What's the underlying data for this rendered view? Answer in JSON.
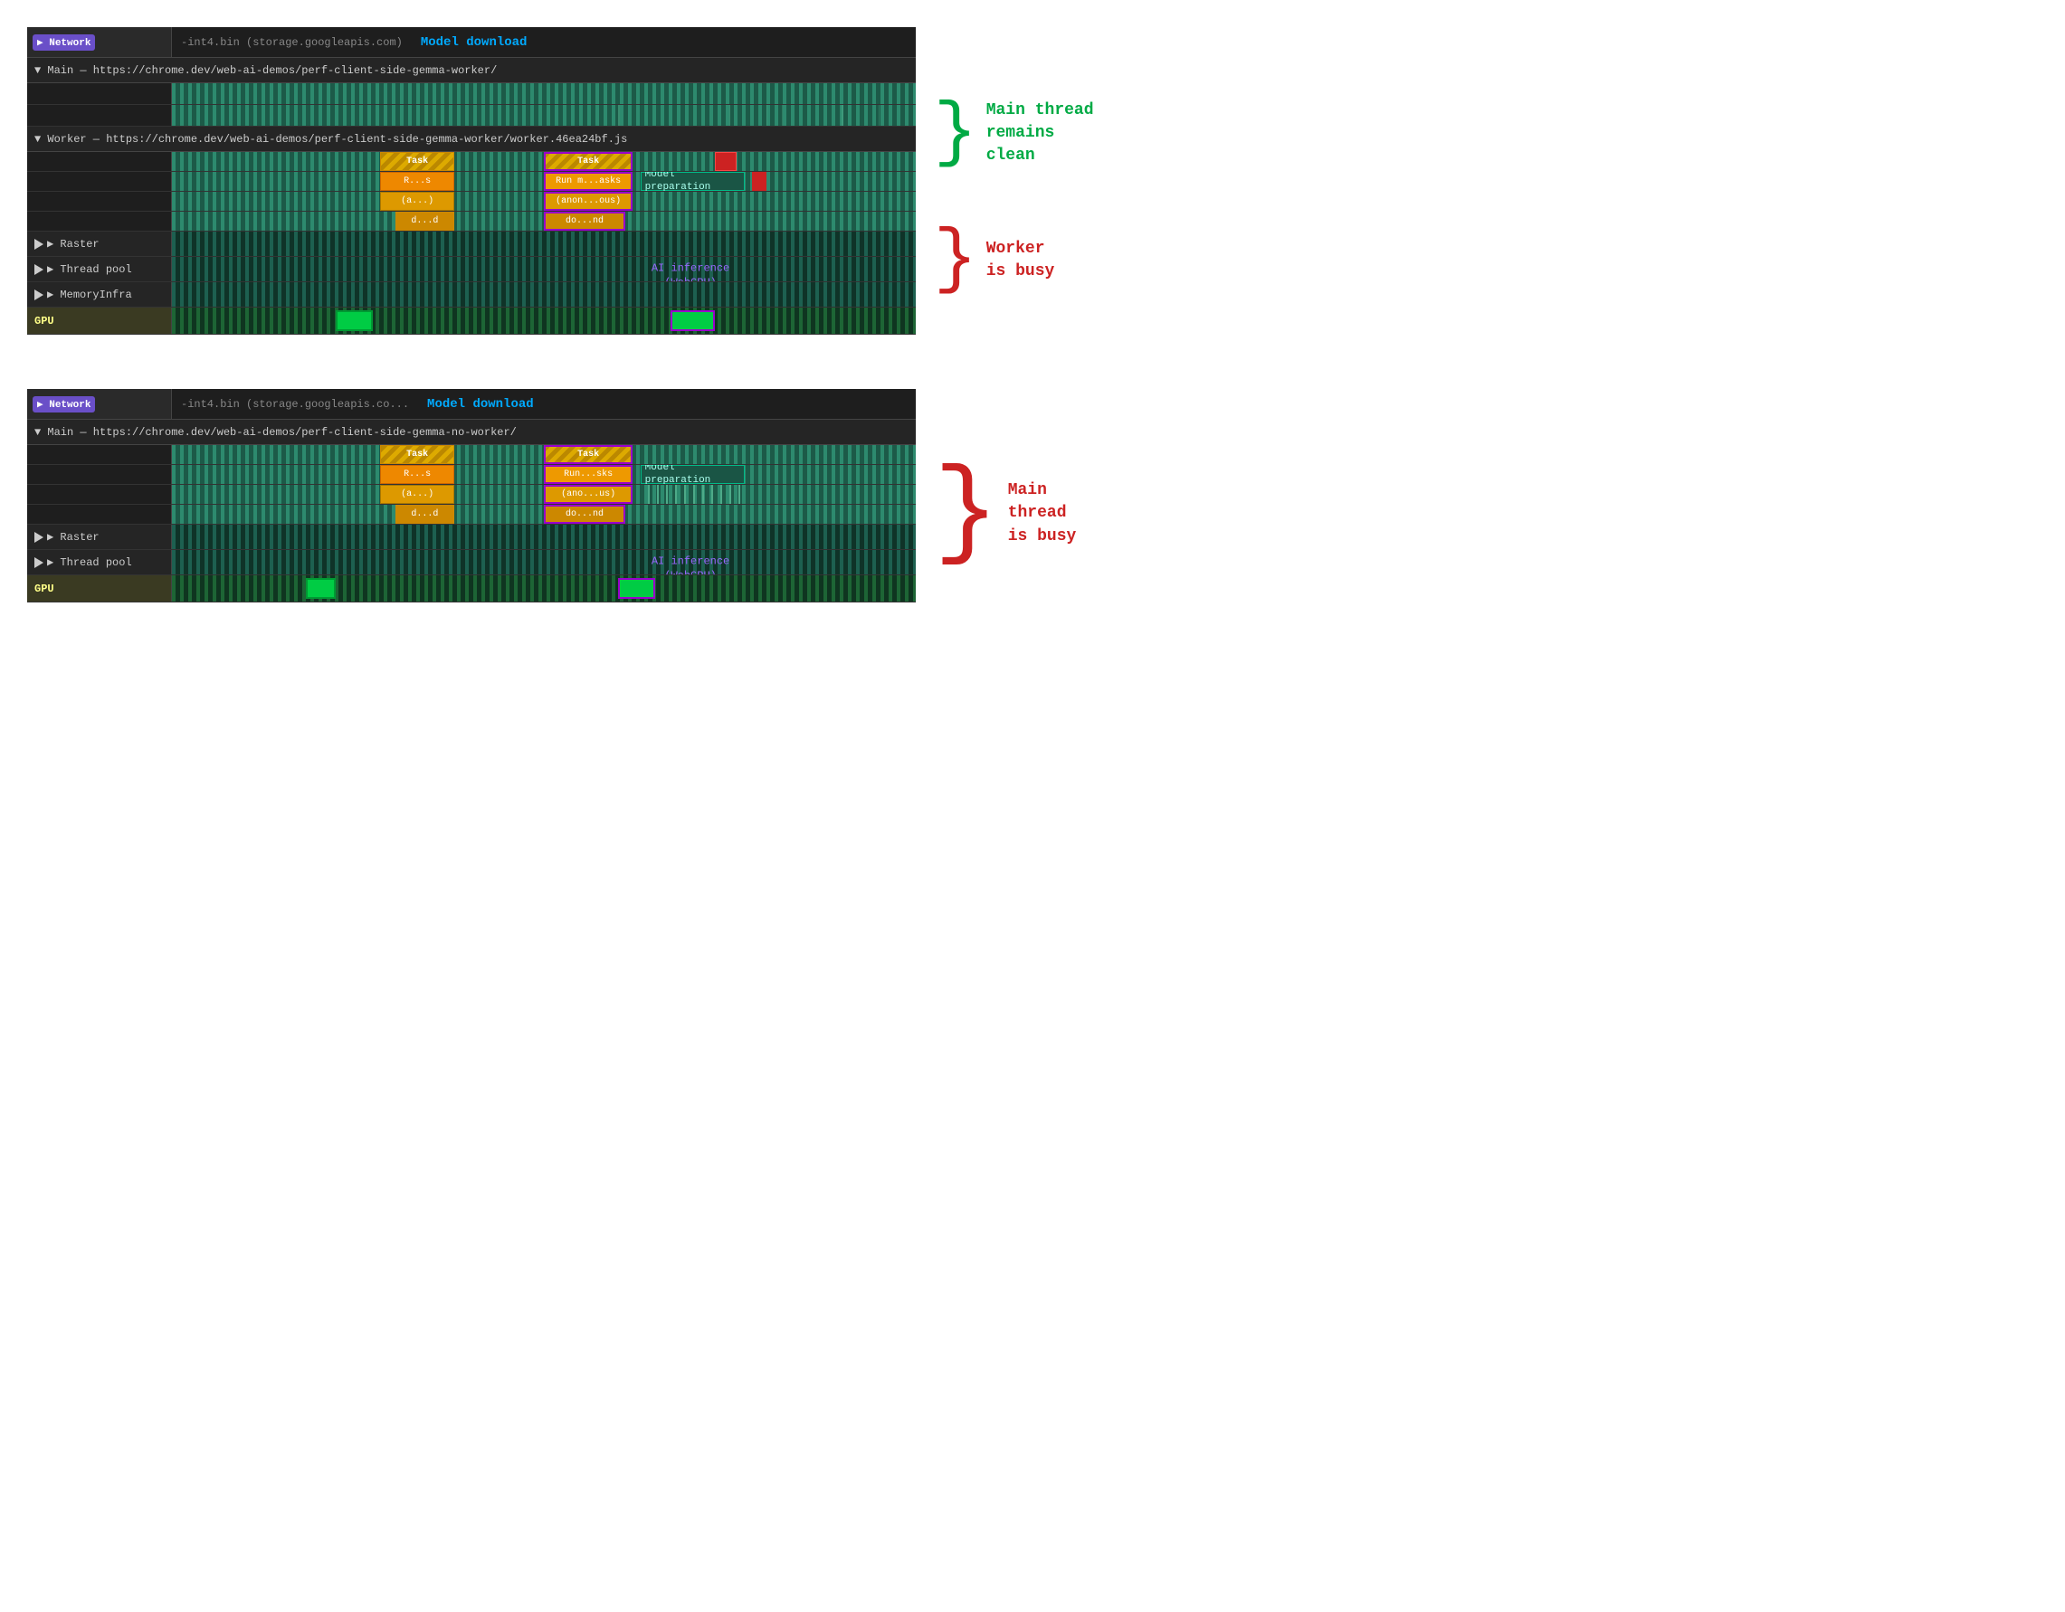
{
  "diagram1": {
    "network_badge": "▶ Network",
    "network_url": "-int4.bin (storage.googleapis.com)",
    "model_download": "Model  download",
    "main_url": "▼ Main — https://chrome.dev/web-ai-demos/perf-client-side-gemma-worker/",
    "worker_url": "▼ Worker — https://chrome.dev/web-ai-demos/perf-client-side-gemma-worker/worker.46ea24bf.js",
    "raster_label": "▶ Raster",
    "thread_pool_label": "▶ Thread pool",
    "memory_infra_label": "▶ MemoryInfra",
    "gpu_label": "GPU",
    "task1": "Task",
    "task2": "Task",
    "run_s": "R...s",
    "run_masks": "Run m...asks",
    "anon_a": "(a...)",
    "anon_ous": "(anon...ous)",
    "dd": "d...d",
    "dond": "do...nd",
    "model_preparation": "Model\npreparation",
    "ai_inference": "AI inference\n(WebGPU)",
    "annotation1_text": "Main thread\nremains clean",
    "annotation2_text": "Worker\nis busy"
  },
  "diagram2": {
    "network_badge": "▶ Network",
    "network_url": "-int4.bin (storage.googleapis.co...",
    "model_download": "Model  download",
    "main_url": "▼ Main — https://chrome.dev/web-ai-demos/perf-client-side-gemma-no-worker/",
    "raster_label": "▶ Raster",
    "thread_pool_label": "▶ Thread pool",
    "gpu_label": "GPU",
    "task1": "Task",
    "task2": "Task",
    "run_s": "R...s",
    "run_sks": "Run...sks",
    "anon_a": "(a...)",
    "anon_us": "(ano...us)",
    "dd": "d...d",
    "dond": "do...nd",
    "model_preparation": "Model\npreparation",
    "ai_inference": "AI inference\n(WebGPU)",
    "annotation_text": "Main thread\nis busy"
  }
}
